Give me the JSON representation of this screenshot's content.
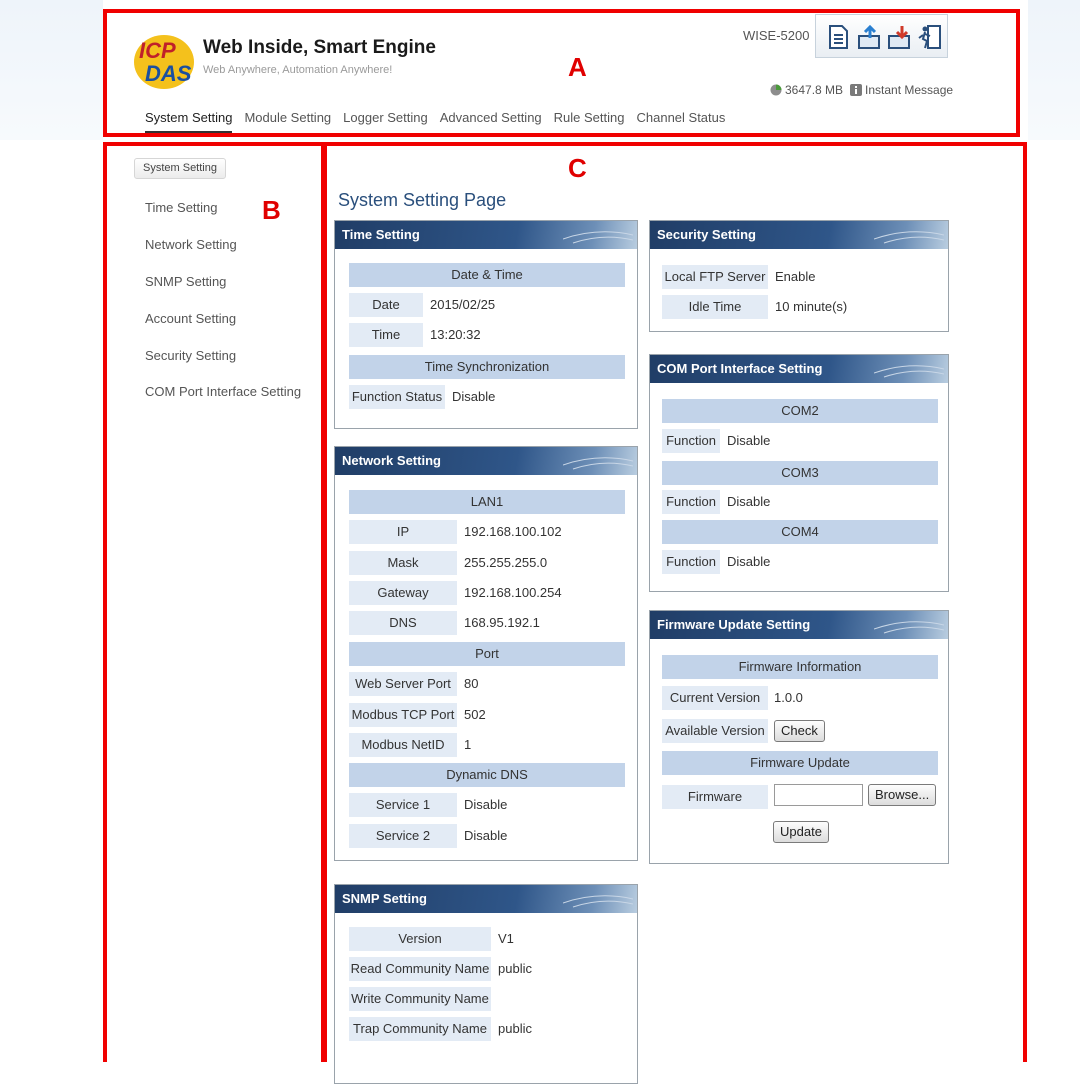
{
  "header": {
    "brand": "Web Inside, Smart Engine",
    "tagline": "Web Anywhere, Automation Anywhere!",
    "model": "WISE-5200",
    "memory": "3647.8 MB",
    "instant_message": "Instant Message",
    "logo_text": "ICP DAS"
  },
  "nav": {
    "tabs": [
      "System Setting",
      "Module Setting",
      "Logger Setting",
      "Advanced Setting",
      "Rule Setting",
      "Channel Status"
    ]
  },
  "annotations": {
    "a": "A",
    "b": "B",
    "c": "C"
  },
  "sidebar": {
    "breadcrumb": "System Setting",
    "items": [
      "Time Setting",
      "Network Setting",
      "SNMP Setting",
      "Account Setting",
      "Security Setting",
      "COM Port Interface Setting"
    ]
  },
  "main": {
    "title": "System Setting Page",
    "time": {
      "title": "Time Setting",
      "section1": "Date & Time",
      "date_label": "Date",
      "date_value": "2015/02/25",
      "time_label": "Time",
      "time_value": "13:20:32",
      "section2": "Time Synchronization",
      "func_label": "Function Status",
      "func_value": "Disable"
    },
    "network": {
      "title": "Network Setting",
      "lan": "LAN1",
      "ip_label": "IP",
      "ip_value": "192.168.100.102",
      "mask_label": "Mask",
      "mask_value": "255.255.255.0",
      "gw_label": "Gateway",
      "gw_value": "192.168.100.254",
      "dns_label": "DNS",
      "dns_value": "168.95.192.1",
      "port": "Port",
      "web_label": "Web Server Port",
      "web_value": "80",
      "modbus_label": "Modbus TCP Port",
      "modbus_value": "502",
      "netid_label": "Modbus NetID",
      "netid_value": "1",
      "ddns": "Dynamic DNS",
      "svc1_label": "Service 1",
      "svc1_value": "Disable",
      "svc2_label": "Service 2",
      "svc2_value": "Disable"
    },
    "snmp": {
      "title": "SNMP Setting",
      "version_label": "Version",
      "version_value": "V1",
      "read_label": "Read Community Name",
      "read_value": "public",
      "write_label": "Write Community Name",
      "write_value": "",
      "trap_label": "Trap Community Name",
      "trap_value": "public"
    },
    "security": {
      "title": "Security Setting",
      "ftp_label": "Local FTP Server",
      "ftp_value": "Enable",
      "idle_label": "Idle Time",
      "idle_value": "10 minute(s)"
    },
    "com": {
      "title": "COM Port Interface Setting",
      "com2": "COM2",
      "com3": "COM3",
      "com4": "COM4",
      "func_label": "Function",
      "com2_value": "Disable",
      "com3_value": "Disable",
      "com4_value": "Disable"
    },
    "firmware": {
      "title": "Firmware Update Setting",
      "info": "Firmware Information",
      "current_label": "Current Version",
      "current_value": "1.0.0",
      "available_label": "Available Version",
      "check_button": "Check",
      "update_section": "Firmware Update",
      "firmware_label": "Firmware",
      "firmware_value": "",
      "browse_button": "Browse...",
      "update_button": "Update"
    }
  },
  "colors": {
    "annotation": "#f00000",
    "header_bar": "#2f5689",
    "section_bg": "#c2d3e9",
    "label_bg": "#e3ebf5",
    "title": "#2a4f7c"
  }
}
